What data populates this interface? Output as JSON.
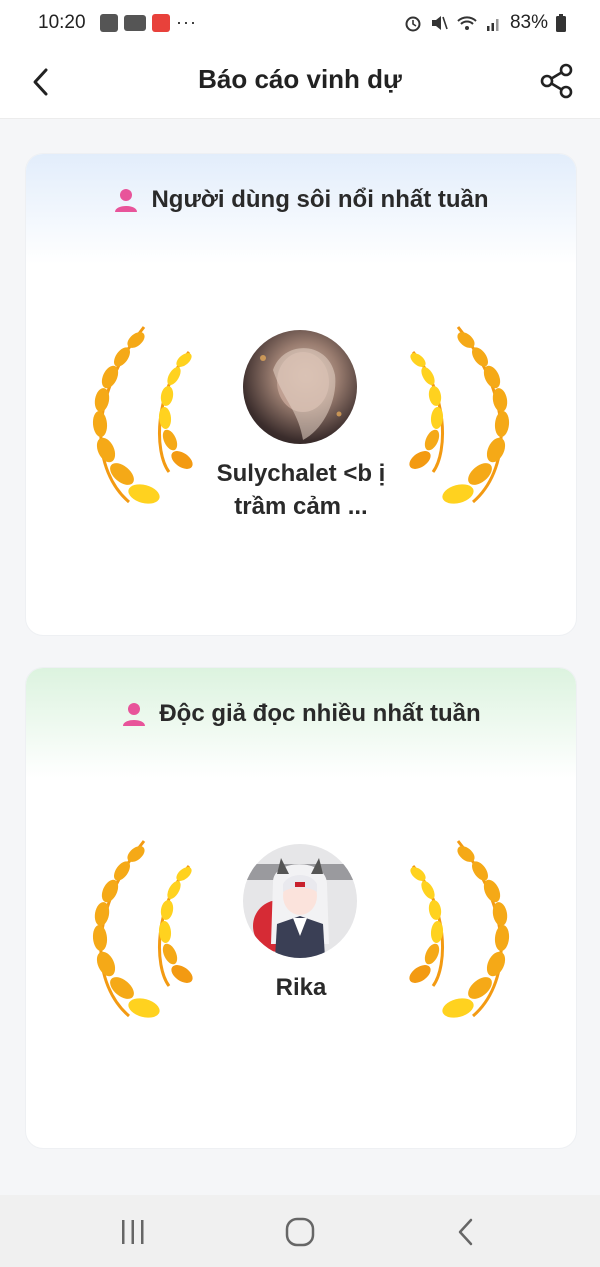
{
  "status_bar": {
    "time": "10:20",
    "battery": "83%",
    "notification_icons": [
      "shopee-icon",
      "youtube-icon",
      "mangatoon-icon",
      "more-dots-icon"
    ],
    "system_icons": [
      "alarm-icon",
      "mute-icon",
      "wifi-icon",
      "signal-icon",
      "battery-icon"
    ]
  },
  "header": {
    "title": "Báo cáo vinh dự"
  },
  "sections": [
    {
      "title": "Người dùng sôi nổi nhất tuần",
      "winner_name": "Sulychalet <b ị trầm cảm ...",
      "accent": "#e2edfb"
    },
    {
      "title": "Độc giả đọc nhiều nhất tuần",
      "winner_name": "Rika",
      "accent": "#dcf3df"
    }
  ],
  "colors": {
    "user_icon": "#e8549a",
    "laurel_light": "#ffd21f",
    "laurel_dark": "#f39a12"
  },
  "nav_bar": [
    "recent-apps-icon",
    "home-icon",
    "back-icon"
  ]
}
